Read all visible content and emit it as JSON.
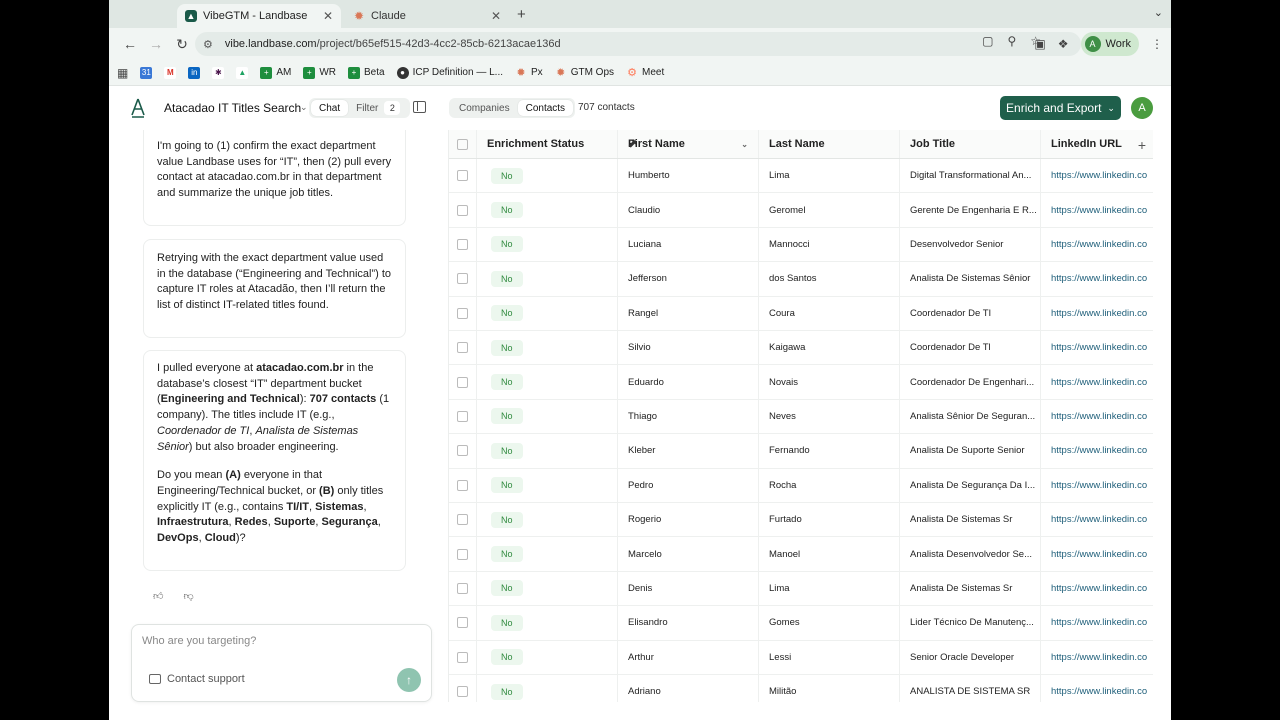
{
  "browser": {
    "tabs": [
      {
        "title": "VibeGTM - Landbase",
        "active": true
      },
      {
        "title": "Claude",
        "active": false
      }
    ],
    "url_domain": "vibe.landbase.com",
    "url_path": "/project/b65ef515-42d3-4cc2-85cb-6213acae136d",
    "profile_label": "Work",
    "profile_initial": "A",
    "bookmarks": [
      "AM",
      "WR",
      "Beta",
      "ICP Definition — L...",
      "Px",
      "GTM Ops",
      "Meet"
    ]
  },
  "header": {
    "project_title": "Atacadao IT Titles Search",
    "chat_tab": "Chat",
    "filter_tab": "Filter",
    "filter_count": "2",
    "companies_tab": "Companies",
    "contacts_tab": "Contacts",
    "contacts_count": "707 contacts",
    "enrich_button": "Enrich and Export",
    "user_initial": "A"
  },
  "chat": {
    "msg1": "I'm going to (1) confirm the exact department value Landbase uses for “IT”, then (2) pull every contact at atacadao.com.br in that department and summarize the unique job titles.",
    "msg2": "Retrying with the exact department value used in the database (“Engineering and Technical”) to capture IT roles at Atacadão, then I’ll return the list of distinct IT-related titles found.",
    "msg3": {
      "a1": "I pulled everyone at ",
      "domain": "atacadao.com.br",
      "a2": " in the database’s closest “IT” department bucket (",
      "bucket": "Engineering and Technical",
      "a3": "): ",
      "count": "707 contacts",
      "a4": " (1 company). The titles include IT (e.g., ",
      "ex1": "Coordenador de TI",
      "a5": ", ",
      "ex2": "Analista de Sistemas Sênior",
      "a6": ") but also broader engineering.",
      "b1": "Do you mean ",
      "optA": "(A)",
      "b2": " everyone in that Engineering/Technical bucket, or ",
      "optB": "(B)",
      "b3": " only titles explicitly IT (e.g., contains ",
      "k1": "TI/IT",
      "k2": "Sistemas",
      "k3": "Infraestrutura",
      "k4": "Redes",
      "k5": "Suporte",
      "k6": "Segurança",
      "k7": "DevOps",
      "k8": "Cloud",
      "sep": ", ",
      "b4": ")?"
    },
    "placeholder": "Who are you targeting?",
    "support_label": "Contact support"
  },
  "table": {
    "columns": [
      "Enrichment Status",
      "First Name",
      "Last Name",
      "Job Title",
      "LinkedIn URL"
    ],
    "rows": [
      {
        "status": "No",
        "first": "Humberto",
        "last": "Lima",
        "title": "Digital Transformational An...",
        "linkedin": "https://www.linkedin.co"
      },
      {
        "status": "No",
        "first": "Claudio",
        "last": "Geromel",
        "title": "Gerente De Engenharia E R...",
        "linkedin": "https://www.linkedin.co"
      },
      {
        "status": "No",
        "first": "Luciana",
        "last": "Mannocci",
        "title": "Desenvolvedor Senior",
        "linkedin": "https://www.linkedin.co"
      },
      {
        "status": "No",
        "first": "Jefferson",
        "last": "dos Santos",
        "title": "Analista De Sistemas Sênior",
        "linkedin": "https://www.linkedin.co"
      },
      {
        "status": "No",
        "first": "Rangel",
        "last": "Coura",
        "title": "Coordenador De TI",
        "linkedin": "https://www.linkedin.co"
      },
      {
        "status": "No",
        "first": "Silvio",
        "last": "Kaigawa",
        "title": "Coordenador De Tl",
        "linkedin": "https://www.linkedin.co"
      },
      {
        "status": "No",
        "first": "Eduardo",
        "last": "Novais",
        "title": "Coordenador De Engenhari...",
        "linkedin": "https://www.linkedin.co"
      },
      {
        "status": "No",
        "first": "Thiago",
        "last": "Neves",
        "title": "Analista Sênior De Seguran...",
        "linkedin": "https://www.linkedin.co"
      },
      {
        "status": "No",
        "first": "Kleber",
        "last": "Fernando",
        "title": "Analista De Suporte Senior",
        "linkedin": "https://www.linkedin.co"
      },
      {
        "status": "No",
        "first": "Pedro",
        "last": "Rocha",
        "title": "Analista De Segurança Da I...",
        "linkedin": "https://www.linkedin.co"
      },
      {
        "status": "No",
        "first": "Rogerio",
        "last": "Furtado",
        "title": "Analista De Sistemas Sr",
        "linkedin": "https://www.linkedin.co"
      },
      {
        "status": "No",
        "first": "Marcelo",
        "last": "Manoel",
        "title": "Analista Desenvolvedor Se...",
        "linkedin": "https://www.linkedin.co"
      },
      {
        "status": "No",
        "first": "Denis",
        "last": "Lima",
        "title": "Analista De Sistemas Sr",
        "linkedin": "https://www.linkedin.co"
      },
      {
        "status": "No",
        "first": "Elisandro",
        "last": "Gomes",
        "title": "Lider Técnico De Manutenç...",
        "linkedin": "https://www.linkedin.co"
      },
      {
        "status": "No",
        "first": "Arthur",
        "last": "Lessi",
        "title": "Senior Oracle Developer",
        "linkedin": "https://www.linkedin.co"
      },
      {
        "status": "No",
        "first": "Adriano",
        "last": "Militão",
        "title": "ANALISTA DE SISTEMA SR",
        "linkedin": "https://www.linkedin.co"
      }
    ]
  },
  "colors": {
    "brand": "#1f5f4b",
    "status_green": "#2f8a3e",
    "status_bg": "#ecf7ee"
  }
}
